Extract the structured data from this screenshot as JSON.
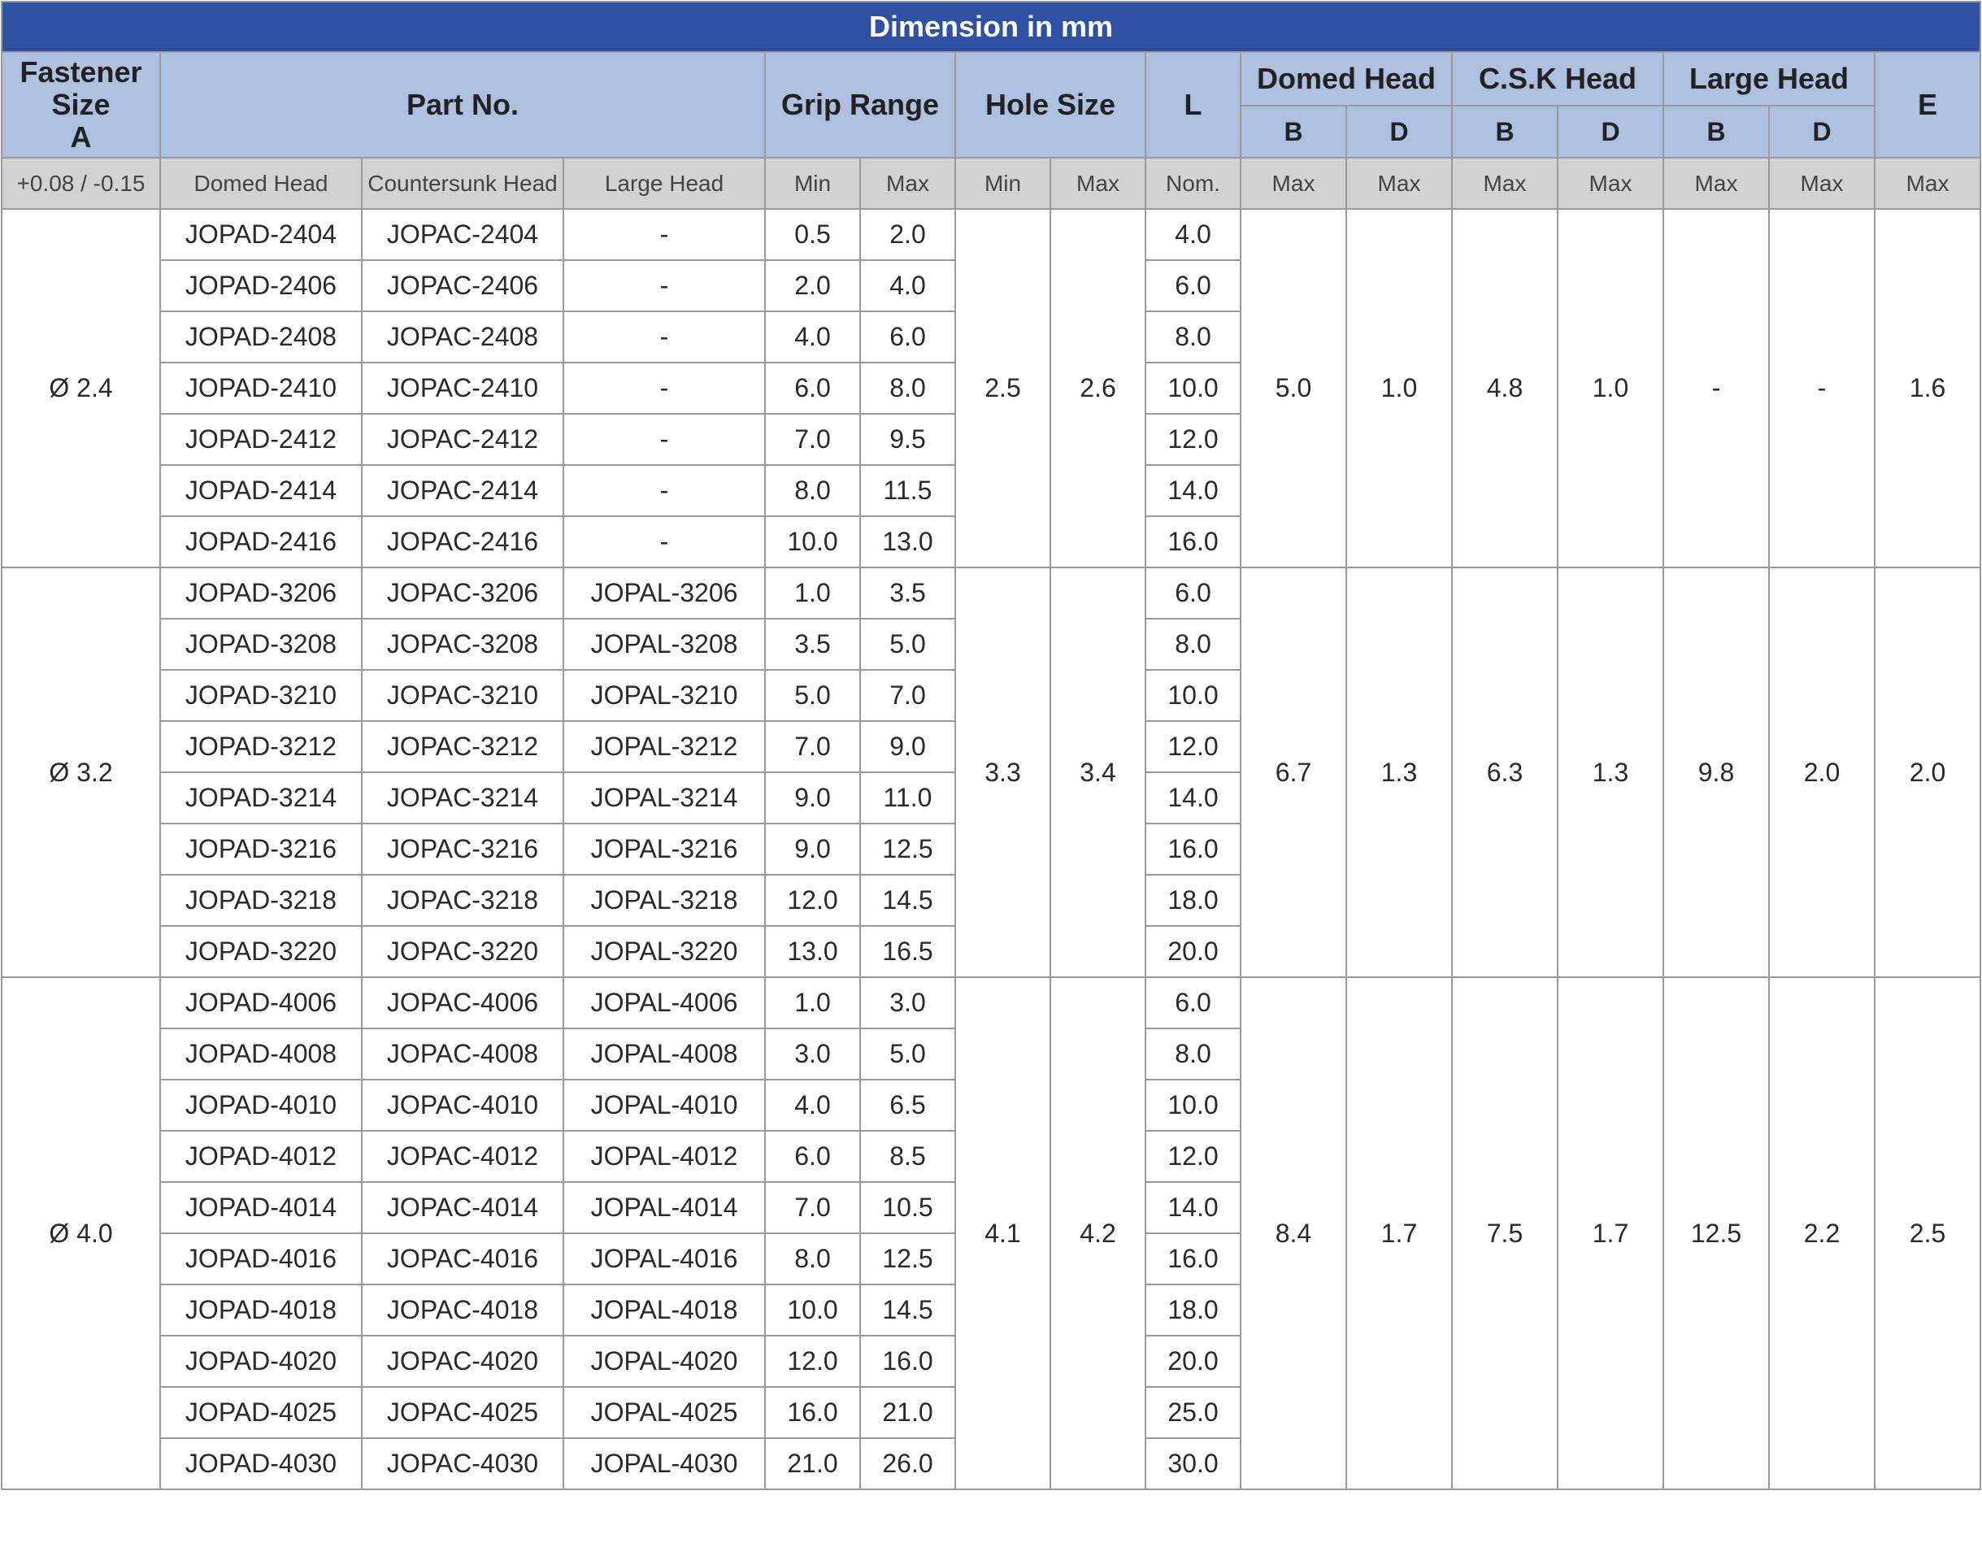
{
  "title": "Dimension in mm",
  "headers": {
    "fastener_size": [
      "Fastener",
      "Size",
      "A"
    ],
    "part_no": "Part No.",
    "grip_range": "Grip Range",
    "hole_size": "Hole Size",
    "l": "L",
    "domed_head": "Domed Head",
    "csk_head": "C.S.K Head",
    "large_head": "Large Head",
    "e": "E",
    "b": "B",
    "d": "D"
  },
  "units": [
    "+0.08 / -0.15",
    "Domed Head",
    "Countersunk Head",
    "Large Head",
    "Min",
    "Max",
    "Min",
    "Max",
    "Nom.",
    "Max",
    "Max",
    "Max",
    "Max",
    "Max",
    "Max",
    "Max"
  ],
  "groups": [
    {
      "size": "Ø 2.4",
      "hole_min": "2.5",
      "hole_max": "2.6",
      "domed_b": "5.0",
      "domed_d": "1.0",
      "csk_b": "4.8",
      "csk_d": "1.0",
      "large_b": "-",
      "large_d": "-",
      "e": "1.6",
      "rows": [
        {
          "domed": "JOPAD-2404",
          "csk": "JOPAC-2404",
          "large": "-",
          "grip_min": "0.5",
          "grip_max": "2.0",
          "l": "4.0"
        },
        {
          "domed": "JOPAD-2406",
          "csk": "JOPAC-2406",
          "large": "-",
          "grip_min": "2.0",
          "grip_max": "4.0",
          "l": "6.0"
        },
        {
          "domed": "JOPAD-2408",
          "csk": "JOPAC-2408",
          "large": "-",
          "grip_min": "4.0",
          "grip_max": "6.0",
          "l": "8.0"
        },
        {
          "domed": "JOPAD-2410",
          "csk": "JOPAC-2410",
          "large": "-",
          "grip_min": "6.0",
          "grip_max": "8.0",
          "l": "10.0"
        },
        {
          "domed": "JOPAD-2412",
          "csk": "JOPAC-2412",
          "large": "-",
          "grip_min": "7.0",
          "grip_max": "9.5",
          "l": "12.0"
        },
        {
          "domed": "JOPAD-2414",
          "csk": "JOPAC-2414",
          "large": "-",
          "grip_min": "8.0",
          "grip_max": "11.5",
          "l": "14.0"
        },
        {
          "domed": "JOPAD-2416",
          "csk": "JOPAC-2416",
          "large": "-",
          "grip_min": "10.0",
          "grip_max": "13.0",
          "l": "16.0"
        }
      ]
    },
    {
      "size": "Ø 3.2",
      "hole_min": "3.3",
      "hole_max": "3.4",
      "domed_b": "6.7",
      "domed_d": "1.3",
      "csk_b": "6.3",
      "csk_d": "1.3",
      "large_b": "9.8",
      "large_d": "2.0",
      "e": "2.0",
      "rows": [
        {
          "domed": "JOPAD-3206",
          "csk": "JOPAC-3206",
          "large": "JOPAL-3206",
          "grip_min": "1.0",
          "grip_max": "3.5",
          "l": "6.0"
        },
        {
          "domed": "JOPAD-3208",
          "csk": "JOPAC-3208",
          "large": "JOPAL-3208",
          "grip_min": "3.5",
          "grip_max": "5.0",
          "l": "8.0"
        },
        {
          "domed": "JOPAD-3210",
          "csk": "JOPAC-3210",
          "large": "JOPAL-3210",
          "grip_min": "5.0",
          "grip_max": "7.0",
          "l": "10.0"
        },
        {
          "domed": "JOPAD-3212",
          "csk": "JOPAC-3212",
          "large": "JOPAL-3212",
          "grip_min": "7.0",
          "grip_max": "9.0",
          "l": "12.0"
        },
        {
          "domed": "JOPAD-3214",
          "csk": "JOPAC-3214",
          "large": "JOPAL-3214",
          "grip_min": "9.0",
          "grip_max": "11.0",
          "l": "14.0"
        },
        {
          "domed": "JOPAD-3216",
          "csk": "JOPAC-3216",
          "large": "JOPAL-3216",
          "grip_min": "9.0",
          "grip_max": "12.5",
          "l": "16.0"
        },
        {
          "domed": "JOPAD-3218",
          "csk": "JOPAC-3218",
          "large": "JOPAL-3218",
          "grip_min": "12.0",
          "grip_max": "14.5",
          "l": "18.0"
        },
        {
          "domed": "JOPAD-3220",
          "csk": "JOPAC-3220",
          "large": "JOPAL-3220",
          "grip_min": "13.0",
          "grip_max": "16.5",
          "l": "20.0"
        }
      ]
    },
    {
      "size": "Ø 4.0",
      "hole_min": "4.1",
      "hole_max": "4.2",
      "domed_b": "8.4",
      "domed_d": "1.7",
      "csk_b": "7.5",
      "csk_d": "1.7",
      "large_b": "12.5",
      "large_d": "2.2",
      "e": "2.5",
      "rows": [
        {
          "domed": "JOPAD-4006",
          "csk": "JOPAC-4006",
          "large": "JOPAL-4006",
          "grip_min": "1.0",
          "grip_max": "3.0",
          "l": "6.0"
        },
        {
          "domed": "JOPAD-4008",
          "csk": "JOPAC-4008",
          "large": "JOPAL-4008",
          "grip_min": "3.0",
          "grip_max": "5.0",
          "l": "8.0"
        },
        {
          "domed": "JOPAD-4010",
          "csk": "JOPAC-4010",
          "large": "JOPAL-4010",
          "grip_min": "4.0",
          "grip_max": "6.5",
          "l": "10.0"
        },
        {
          "domed": "JOPAD-4012",
          "csk": "JOPAC-4012",
          "large": "JOPAL-4012",
          "grip_min": "6.0",
          "grip_max": "8.5",
          "l": "12.0"
        },
        {
          "domed": "JOPAD-4014",
          "csk": "JOPAC-4014",
          "large": "JOPAL-4014",
          "grip_min": "7.0",
          "grip_max": "10.5",
          "l": "14.0"
        },
        {
          "domed": "JOPAD-4016",
          "csk": "JOPAC-4016",
          "large": "JOPAL-4016",
          "grip_min": "8.0",
          "grip_max": "12.5",
          "l": "16.0"
        },
        {
          "domed": "JOPAD-4018",
          "csk": "JOPAC-4018",
          "large": "JOPAL-4018",
          "grip_min": "10.0",
          "grip_max": "14.5",
          "l": "18.0"
        },
        {
          "domed": "JOPAD-4020",
          "csk": "JOPAC-4020",
          "large": "JOPAL-4020",
          "grip_min": "12.0",
          "grip_max": "16.0",
          "l": "20.0"
        },
        {
          "domed": "JOPAD-4025",
          "csk": "JOPAC-4025",
          "large": "JOPAL-4025",
          "grip_min": "16.0",
          "grip_max": "21.0",
          "l": "25.0"
        },
        {
          "domed": "JOPAD-4030",
          "csk": "JOPAC-4030",
          "large": "JOPAL-4030",
          "grip_min": "21.0",
          "grip_max": "26.0",
          "l": "30.0"
        }
      ]
    }
  ]
}
